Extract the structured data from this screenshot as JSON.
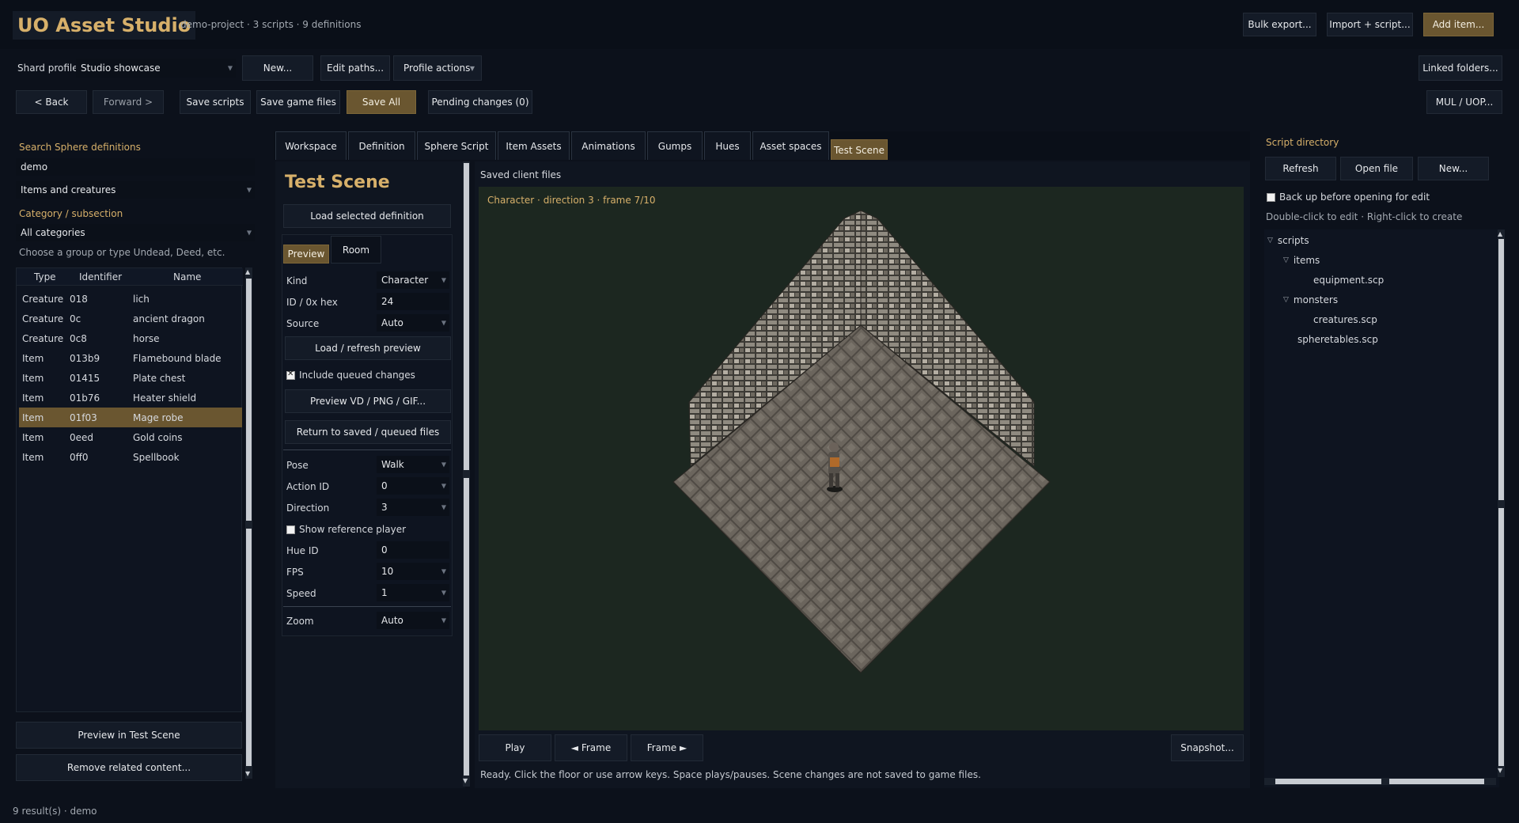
{
  "app": {
    "title": "UO Asset Studio",
    "subtitle": "demo-project · 3 scripts · 9 definitions",
    "header_buttons": [
      "Bulk export...",
      "Import + script...",
      "Add item..."
    ]
  },
  "profile": {
    "label": "Shard profile",
    "value": "Studio showcase",
    "new": "New...",
    "edit_paths": "Edit paths...",
    "actions": "Profile actions",
    "linked": "Linked folders..."
  },
  "toolbar": {
    "back": "< Back",
    "forward": "Forward >",
    "save_scripts": "Save scripts",
    "save_game": "Save game files",
    "save_all": "Save All",
    "pending": "Pending changes (0)",
    "mul": "MUL / UOP..."
  },
  "left": {
    "search_label": "Search Sphere definitions",
    "search_value": "demo",
    "scope": "Items and creatures",
    "category_label": "Category / subsection",
    "category_value": "All categories",
    "hint": "Choose a group or type Undead, Deed, etc.",
    "columns": [
      "Type",
      "Identifier",
      "Name"
    ],
    "rows": [
      {
        "type": "Creature",
        "id": "018",
        "name": "lich"
      },
      {
        "type": "Creature",
        "id": "0c",
        "name": "ancient dragon"
      },
      {
        "type": "Creature",
        "id": "0c8",
        "name": "horse"
      },
      {
        "type": "Item",
        "id": "013b9",
        "name": "Flamebound blade"
      },
      {
        "type": "Item",
        "id": "01415",
        "name": "Plate chest"
      },
      {
        "type": "Item",
        "id": "01b76",
        "name": "Heater shield"
      },
      {
        "type": "Item",
        "id": "01f03",
        "name": "Mage robe"
      },
      {
        "type": "Item",
        "id": "0eed",
        "name": "Gold coins"
      },
      {
        "type": "Item",
        "id": "0ff0",
        "name": "Spellbook"
      }
    ],
    "preview_btn": "Preview in Test Scene",
    "remove_btn": "Remove related content..."
  },
  "status": "9 result(s) · demo",
  "tabs": [
    "Workspace",
    "Definition",
    "Sphere Script",
    "Item Assets",
    "Animations",
    "Gumps",
    "Hues",
    "Asset spaces",
    "Test Scene"
  ],
  "scene": {
    "title": "Test Scene",
    "load_def": "Load selected definition",
    "subtabs": [
      "Preview",
      "Room"
    ],
    "kind_label": "Kind",
    "kind": "Character",
    "id_label": "ID / 0x hex",
    "id": "24",
    "source_label": "Source",
    "source": "Auto",
    "refresh": "Load / refresh preview",
    "include_queued": "Include queued changes",
    "preview_export": "Preview VD / PNG / GIF...",
    "return_saved": "Return to saved / queued files",
    "pose_label": "Pose",
    "pose": "Walk",
    "action_label": "Action ID",
    "action": "0",
    "direction_label": "Direction",
    "direction": "3",
    "show_ref": "Show reference player",
    "hue_label": "Hue ID",
    "hue": "0",
    "fps_label": "FPS",
    "fps": "10",
    "speed_label": "Speed",
    "speed": "1",
    "zoom_label": "Zoom",
    "zoom": "Auto"
  },
  "viewer": {
    "heading": "Saved client files",
    "caption": "Character · direction 3 · frame 7/10",
    "play": "Play",
    "prev": "◄ Frame",
    "next": "Frame ►",
    "snapshot": "Snapshot...",
    "message": "Ready. Click the floor or use arrow keys. Space plays/pauses. Scene changes are not saved to game files."
  },
  "right": {
    "title": "Script directory",
    "refresh": "Refresh",
    "open": "Open file",
    "new": "New...",
    "backup": "Back up before opening for edit",
    "hint": "Double-click to edit · Right-click to create",
    "tree": [
      {
        "label": "scripts",
        "depth": 0,
        "expanded": true
      },
      {
        "label": "items",
        "depth": 1,
        "expanded": true
      },
      {
        "label": "equipment.scp",
        "depth": 2
      },
      {
        "label": "monsters",
        "depth": 1,
        "expanded": true
      },
      {
        "label": "creatures.scp",
        "depth": 2
      },
      {
        "label": "spheretables.scp",
        "depth": 1
      }
    ]
  },
  "colors": {
    "accent": "#6a5630",
    "gold_text": "#d7b06a",
    "bg": "#0c111b",
    "viewport": "#1c2720"
  }
}
